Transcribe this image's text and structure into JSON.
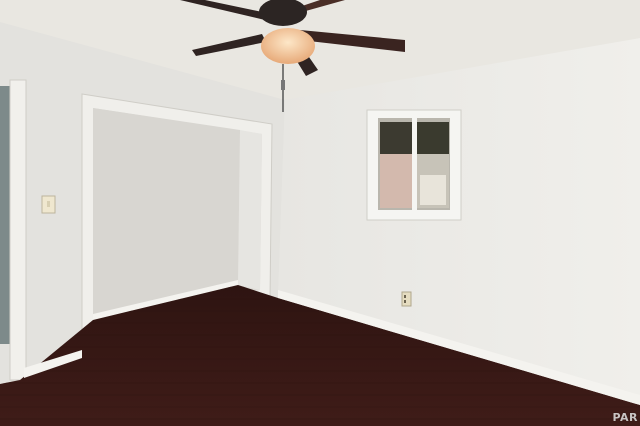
{
  "scene": {
    "description_tag": "empty-bedroom-photo",
    "watermark_text": "PAR",
    "colors": {
      "ceiling": "#e9e7e1",
      "wall_left": "#e4e3df",
      "wall_right": "#ecebe7",
      "closet_interior": "#dedcd7",
      "floor": "#3a1a16",
      "floor_highlight": "#4a241e",
      "baseboard": "#f4f3ef",
      "fan_blade": "#3a2420",
      "fan_light": "#f2c9a0",
      "window_frame": "#f5f5f2",
      "window_glass_dark": "#3c3a30"
    },
    "icons": [
      "ceiling-fan-icon",
      "light-switch-icon",
      "outlet-icon",
      "window-icon"
    ]
  }
}
